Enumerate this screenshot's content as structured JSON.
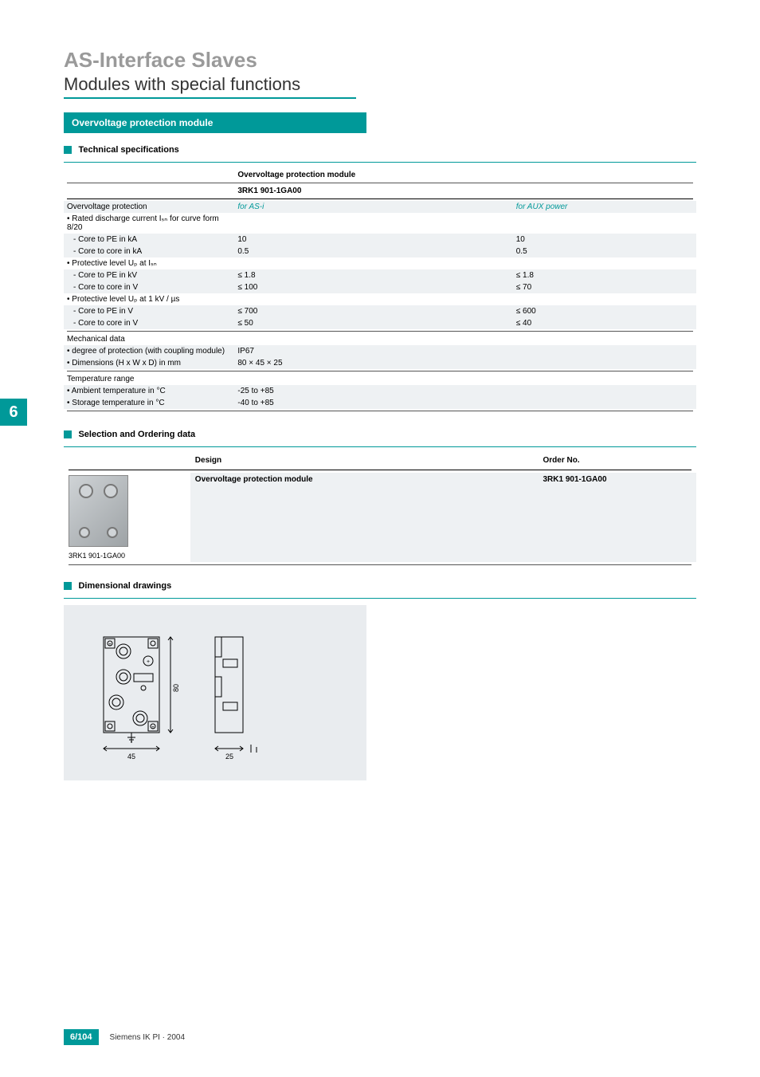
{
  "header": {
    "title": "AS-Interface Slaves",
    "subtitle": "Modules with special functions",
    "section_bar": "Overvoltage protection module"
  },
  "side_tab": "6",
  "tech_specs": {
    "heading": "Technical specifications",
    "col_product": "Overvoltage protection module",
    "col_partno": "3RK1 901-1GA00",
    "col_asi": "for AS-i",
    "col_aux": "for AUX power",
    "rows": {
      "ovp": "Overvoltage protection",
      "rated_discharge": "• Rated discharge current Iₛₙ for curve form 8/20",
      "core_pe_ka": "- Core to PE in kA",
      "core_pe_ka_asi": "10",
      "core_pe_ka_aux": "10",
      "core_core_ka": "- Core to core in kA",
      "core_core_ka_asi": "0.5",
      "core_core_ka_aux": "0.5",
      "plevel_isn": "• Protective level Uₚ at Iₛₙ",
      "core_pe_kv": "- Core to PE in kV",
      "core_pe_kv_asi": "≤ 1.8",
      "core_pe_kv_aux": "≤ 1.8",
      "core_core_v": "- Core to core in V",
      "core_core_v_asi": "≤ 100",
      "core_core_v_aux": "≤ 70",
      "plevel_1kv": "• Protective level Uₚ at 1 kV / µs",
      "core_pe_v2": "- Core to PE in V",
      "core_pe_v2_asi": "≤ 700",
      "core_pe_v2_aux": "≤ 600",
      "core_core_v2": "- Core to core in V",
      "core_core_v2_asi": "≤ 50",
      "core_core_v2_aux": "≤ 40",
      "mech": "Mechanical data",
      "deg_prot": "• degree of protection (with coupling module)",
      "deg_prot_val": "IP67",
      "dims": "• Dimensions (H x W x D) in mm",
      "dims_val": "80 × 45 × 25",
      "temp_range": "Temperature range",
      "ambient": "• Ambient temperature in °C",
      "ambient_val": "-25 to +85",
      "storage": "• Storage temperature in °C",
      "storage_val": "-40 to +85"
    }
  },
  "ordering": {
    "heading": "Selection and Ordering data",
    "col_design": "Design",
    "col_orderno": "Order No.",
    "product_name": "Overvoltage protection module",
    "product_orderno": "3RK1 901-1GA00",
    "thumb_caption": "3RK1 901-1GA00"
  },
  "drawings": {
    "heading": "Dimensional drawings",
    "dim_h": "80",
    "dim_w": "45",
    "dim_d": "25"
  },
  "footer": {
    "page": "6/104",
    "text": "Siemens IK PI · 2004"
  }
}
